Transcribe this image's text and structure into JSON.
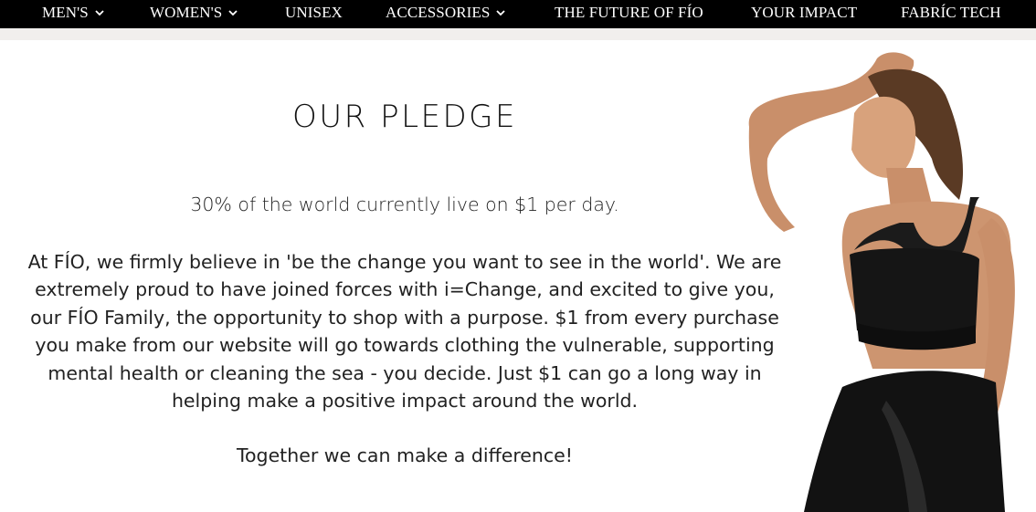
{
  "nav": {
    "items": [
      {
        "label": "MEN'S",
        "has_dropdown": true
      },
      {
        "label": "WOMEN'S",
        "has_dropdown": true
      },
      {
        "label": "UNISEX",
        "has_dropdown": false
      },
      {
        "label": "ACCESSORIES",
        "has_dropdown": true
      },
      {
        "label": "THE FUTURE OF FÍO",
        "has_dropdown": false
      },
      {
        "label": "YOUR IMPACT",
        "has_dropdown": false
      },
      {
        "label": "FABRÍC TECH",
        "has_dropdown": false
      }
    ]
  },
  "pledge": {
    "title": "OUR PLEDGE",
    "lead": "30% of the world currently live on $1 per day.",
    "body": "At FÍO, we firmly believe in 'be the change you want to see in the world'. We are extremely proud to have joined forces with i=Change, and excited to give you, our FÍO Family, the opportunity to shop with a purpose. $1 from every purchase you make from our website will go towards clothing the vulnerable, supporting mental health or cleaning the sea - you decide.  Just $1 can go a long way in helping make a positive impact around the world.",
    "closing": "Together we can make a difference!"
  },
  "colors": {
    "nav_bg": "#000000",
    "nav_text": "#ffffff",
    "underbar": "#f1efed",
    "text": "#222222"
  },
  "icons": {
    "dropdown": "chevron-down-icon"
  }
}
